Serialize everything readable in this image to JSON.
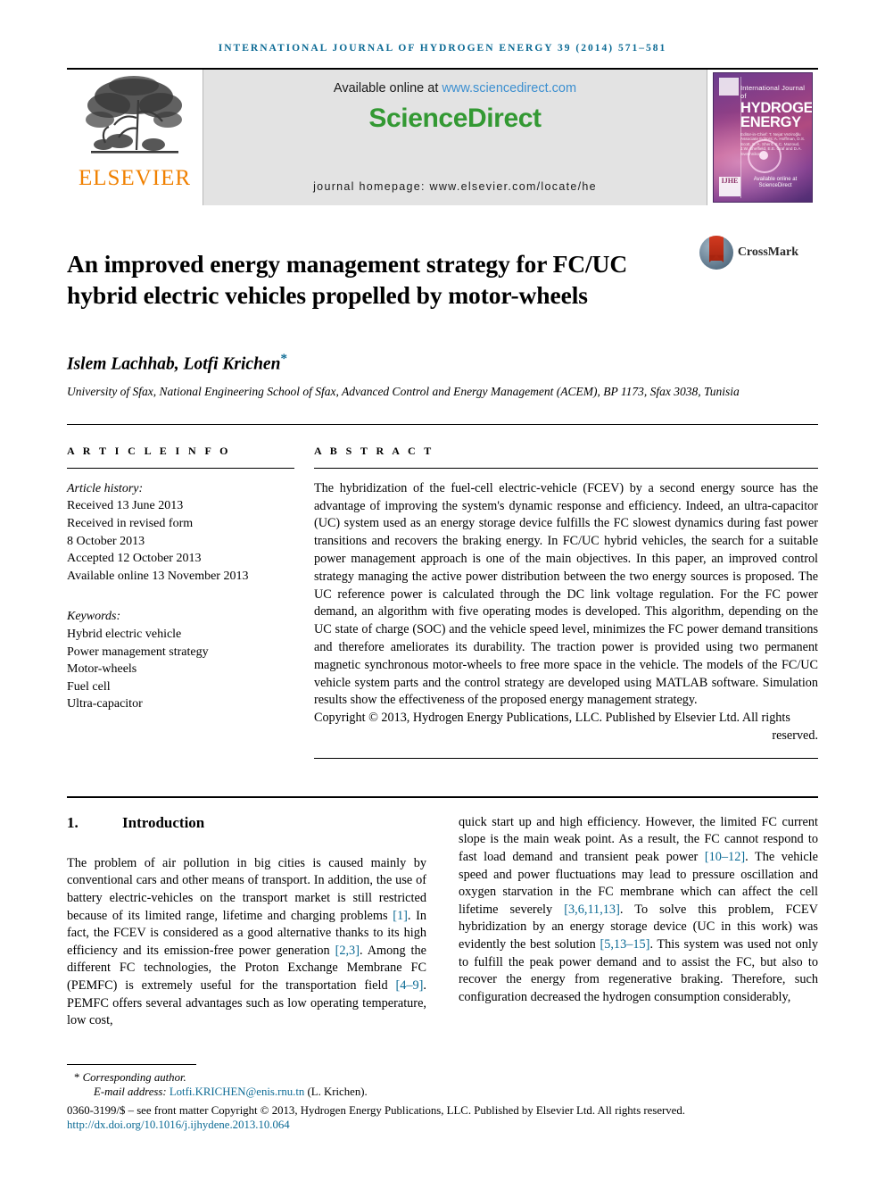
{
  "running_head": "INTERNATIONAL JOURNAL OF HYDROGEN ENERGY 39 (2014) 571–581",
  "masthead": {
    "publisher_name": "ELSEVIER",
    "available_prefix": "Available online at ",
    "available_url": "www.sciencedirect.com",
    "sciencedirect_logo": "ScienceDirect",
    "journal_homepage": "journal homepage: www.elsevier.com/locate/he",
    "cover": {
      "line1": "International Journal of",
      "line2": "HYDROGEN",
      "line3": "ENERGY",
      "editors": "Editor-in-Chief: T. Nejat Veziroğlu    Associate Editors: A. Hoffman, D.S. Scott, S. A. Sherif, S.C. Mazoud, J.W. Sheffield, E.E. Graf and D.A. Sveshnikov",
      "badge": "IJHE",
      "footer": "Available online at ScienceDirect"
    },
    "colors": {
      "header_blue": "#0b6a94",
      "sciencedirect_green": "#339933",
      "elsevier_orange": "#f08000",
      "link_blue": "#3c8fd0"
    }
  },
  "article": {
    "title": "An improved energy management strategy for FC/UC hybrid electric vehicles propelled by motor-wheels",
    "crossmark_label": "CrossMark",
    "authors": "Islem Lachhab, Lotfi Krichen",
    "corresponding_marker": "*",
    "affiliation": "University of Sfax, National Engineering School of Sfax, Advanced Control and Energy Management (ACEM), BP 1173, Sfax 3038, Tunisia"
  },
  "article_info": {
    "label": "A R T I C L E   I N F O",
    "history_label": "Article history:",
    "history": [
      "Received 13 June 2013",
      "Received in revised form",
      "8 October 2013",
      "Accepted 12 October 2013",
      "Available online 13 November 2013"
    ],
    "keywords_label": "Keywords:",
    "keywords": [
      "Hybrid electric vehicle",
      "Power management strategy",
      "Motor-wheels",
      "Fuel cell",
      "Ultra-capacitor"
    ]
  },
  "abstract": {
    "label": "A B S T R A C T",
    "text": "The hybridization of the fuel-cell electric-vehicle (FCEV) by a second energy source has the advantage of improving the system's dynamic response and efficiency. Indeed, an ultra-capacitor (UC) system used as an energy storage device fulfills the FC slowest dynamics during fast power transitions and recovers the braking energy. In FC/UC hybrid vehicles, the search for a suitable power management approach is one of the main objectives. In this paper, an improved control strategy managing the active power distribution between the two energy sources is proposed. The UC reference power is calculated through the DC link voltage regulation. For the FC power demand, an algorithm with five operating modes is developed. This algorithm, depending on the UC state of charge (SOC) and the vehicle speed level, minimizes the FC power demand transitions and therefore ameliorates its durability. The traction power is provided using two permanent magnetic synchronous motor-wheels to free more space in the vehicle. The models of the FC/UC vehicle system parts and the control strategy are developed using MATLAB software. Simulation results show the effectiveness of the proposed energy management strategy.",
    "copyright_main": "Copyright © 2013, Hydrogen Energy Publications, LLC. Published by Elsevier Ltd. All rights",
    "copyright_last": "reserved."
  },
  "section": {
    "number": "1.",
    "heading": "Introduction"
  },
  "body": {
    "left_paragraph_parts": [
      "The problem of air pollution in big cities is caused mainly by conventional cars and other means of transport. In addition, the use of battery electric-vehicles on the transport market is still restricted because of its limited range, lifetime and charging problems ",
      "[1]",
      ". In fact, the FCEV is considered as a good alternative thanks to its high efficiency and its emission-free power generation ",
      "[2,3]",
      ". Among the different FC technologies, the Proton Exchange Membrane FC (PEMFC) is extremely useful for the transportation field ",
      "[4–9]",
      ". PEMFC offers several advantages such as low operating temperature, low cost,"
    ],
    "right_paragraph_parts": [
      "quick start up and high efficiency. However, the limited FC current slope is the main weak point. As a result, the FC cannot respond to fast load demand and transient peak power ",
      "[10–12]",
      ". The vehicle speed and power fluctuations may lead to pressure oscillation and oxygen starvation in the FC membrane which can affect the cell lifetime severely ",
      "[3,6,11,13]",
      ". To solve this problem, FCEV hybridization by an energy storage device (UC in this work) was evidently the best solution ",
      "[5,13–15]",
      ". This system was used not only to fulfill the peak power demand and to assist the FC, but also to recover the energy from regenerative braking. Therefore, such configuration decreased the hydrogen consumption considerably,"
    ]
  },
  "footer": {
    "corresponding_bullet": "*",
    "corresponding_text": "Corresponding author.",
    "email_label": "E-mail address: ",
    "email_address": "Lotfi.KRICHEN@enis.rnu.tn",
    "email_suffix": " (L. Krichen).",
    "issn_line": "0360-3199/$ – see front matter Copyright © 2013, Hydrogen Energy Publications, LLC. Published by Elsevier Ltd. All rights reserved.",
    "doi": "http://dx.doi.org/10.1016/j.ijhydene.2013.10.064"
  }
}
